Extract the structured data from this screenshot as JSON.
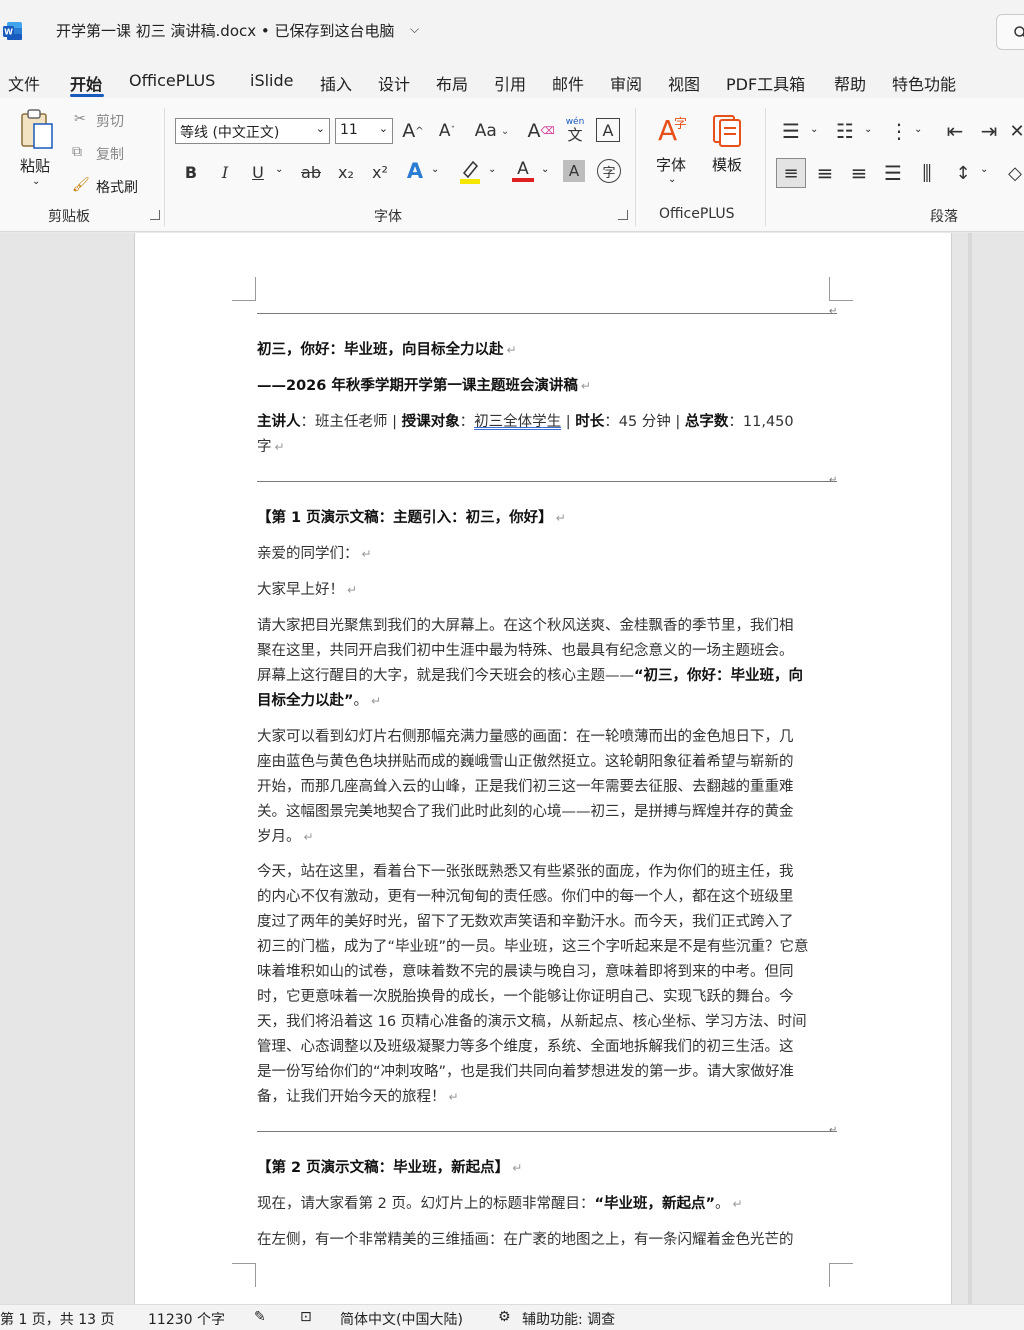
{
  "app": {
    "title": "开学第一课 初三 演讲稿.docx • 已保存到这台电脑",
    "icon": "word-icon"
  },
  "menu": [
    {
      "label": "文件"
    },
    {
      "label": "开始"
    },
    {
      "label": "OfficePLUS"
    },
    {
      "label": "iSlide"
    },
    {
      "label": "插入"
    },
    {
      "label": "设计"
    },
    {
      "label": "布局"
    },
    {
      "label": "引用"
    },
    {
      "label": "邮件"
    },
    {
      "label": "审阅"
    },
    {
      "label": "视图"
    },
    {
      "label": "PDF工具箱"
    },
    {
      "label": "帮助"
    },
    {
      "label": "特色功能"
    }
  ],
  "ribbon": {
    "clipboard": {
      "paste": "粘贴",
      "cut": "剪切",
      "copy": "复制",
      "format_painter": "格式刷",
      "group": "剪贴板"
    },
    "font": {
      "font_name": "等线 (中文正文)",
      "font_size": "11",
      "change_case": "Aa",
      "bold": "B",
      "italic": "I",
      "underline": "U",
      "strike": "ab",
      "subscript": "x₂",
      "superscript": "x²",
      "group": "字体",
      "pinyin_top": "wén",
      "pinyin_bottom": "文"
    },
    "officeplus": {
      "font_btn": "字体",
      "template_btn": "模板",
      "group": "OfficePLUS"
    },
    "paragraph": {
      "group": "段落"
    },
    "colors": {
      "highlight": "#f5e600",
      "font_color": "#e02020",
      "accent": "#185abd"
    }
  },
  "document": {
    "title_line": "初三，你好：毕业班，向目标全力以赴",
    "subtitle_line": "——2026 年秋季学期开学第一课主题班会演讲稿",
    "meta": {
      "speaker_label": "主讲人",
      "speaker": "班主任老师",
      "audience_label": "授课对象",
      "audience": "初三全体学生",
      "duration_label": "时长",
      "duration": "45 分钟",
      "words_label": "总字数",
      "words": "11,450",
      "words_unit": "字"
    },
    "section1_heading": "【第 1 页演示文稿：主题引入：初三，你好】",
    "greeting1": "亲爱的同学们：",
    "greeting2": "大家早上好！",
    "p1_lines": [
      "请大家把目光聚焦到我们的大屏幕上。在这个秋风送爽、金桂飘香的季节里，我们相",
      "聚在这里，共同开启我们初中生涯中最为特殊、也最具有纪念意义的一场主题班会。",
      "屏幕上这行醒目的大字，就是我们今天班会的核心主题——"
    ],
    "p1_bold_a": "“初三，你好：毕业班，向",
    "p1_bold_b": "目标全力以赴”",
    "p1_end": "。",
    "p2_lines": [
      "大家可以看到幻灯片右侧那幅充满力量感的画面：在一轮喷薄而出的金色旭日下，几",
      "座由蓝色与黄色色块拼贴而成的巍峨雪山正傲然挺立。这轮朝阳象征着希望与崭新的",
      "开始，而那几座高耸入云的山峰，正是我们初三这一年需要去征服、去翻越的重重难",
      "关。这幅图景完美地契合了我们此时此刻的心境——初三，是拼搏与辉煌并存的黄金",
      "岁月。"
    ],
    "p3_lines": [
      "今天，站在这里，看着台下一张张既熟悉又有些紧张的面庞，作为你们的班主任，我",
      "的内心不仅有激动，更有一种沉甸甸的责任感。你们中的每一个人，都在这个班级里",
      "度过了两年的美好时光，留下了无数欢声笑语和辛勤汗水。而今天，我们正式跨入了",
      "初三的门槛，成为了“毕业班”的一员。毕业班，这三个字听起来是不是有些沉重？它意",
      "味着堆积如山的试卷，意味着数不完的晨读与晚自习，意味着即将到来的中考。但同",
      "时，它更意味着一次脱胎换骨的成长，一个能够让你证明自己、实现飞跃的舞台。今",
      "天，我们将沿着这 16 页精心准备的演示文稿，从新起点、核心坐标、学习方法、时间",
      "管理、心态调整以及班级凝聚力等多个维度，系统、全面地拆解我们的初三生活。这",
      "是一份写给你们的“冲刺攻略”，也是我们共同向着梦想进发的第一步。请大家做好准",
      "备，让我们开始今天的旅程！"
    ],
    "section2_heading": "【第 2 页演示文稿：毕业班，新起点】",
    "p4_start": "现在，请大家看第 2 页。幻灯片上的标题非常醒目：",
    "p4_bold": "“毕业班，新起点”",
    "p4_end": "。",
    "p5_line": "在左侧，有一个非常精美的三维插画：在广袤的地图之上，有一条闪耀着金色光芒的"
  },
  "status": {
    "page": "第 1 页，共 13 页",
    "words": "11230 个字",
    "language": "简体中文(中国大陆)",
    "accessibility": "辅助功能: 调查"
  }
}
